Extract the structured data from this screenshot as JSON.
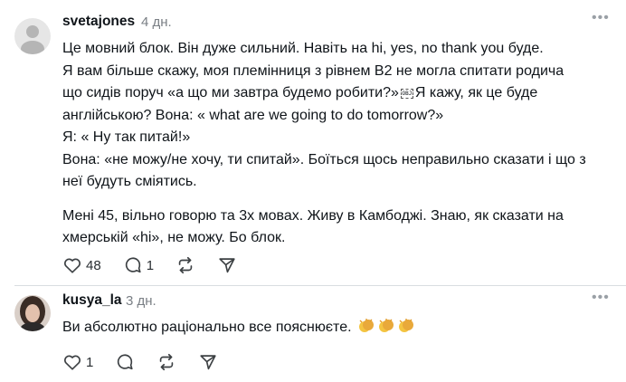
{
  "comments": [
    {
      "username": "svetajones",
      "time": "4 дн.",
      "avatar": "default-avatar",
      "lines": [
        "Це мовний блок. Він дуже сильний. Навіть на hi, yes, no thank you буде.",
        "Я вам більше скажу, моя племінниця з рівнем В2 не могла спитати родича",
        "що сидів поруч «а що ми завтра будемо робити?»",
        "Я кажу, як це буде",
        "англійською? Вона: « what are we going to do tomorrow?»",
        "Я: « Ну так питай!»",
        "Вона: «не можу/не хочу, ти спитай». Боїться щось неправильно сказати і що з",
        "неї будуть сміятись."
      ],
      "emoji_placeholder": "OBJ",
      "paragraph2": [
        "Мені 45, вільно говорю та 3х мовах. Живу в Камбоджі. Знаю, як сказати на",
        "хмерській «hi», не можу. Бо блок."
      ],
      "likes": "48",
      "replies": "1"
    },
    {
      "username": "kusya_la",
      "time": "3 дн.",
      "avatar": "photo-avatar",
      "text": "Ви абсолютно раціонально все пояснюєте.",
      "emojis": [
        "clapping-hands",
        "clapping-hands",
        "clapping-hands"
      ],
      "likes": "1"
    }
  ],
  "colors": {
    "text": "#0f1419",
    "muted": "#7a7f85",
    "divider": "#d9dde1",
    "clap": "#f4c542"
  }
}
